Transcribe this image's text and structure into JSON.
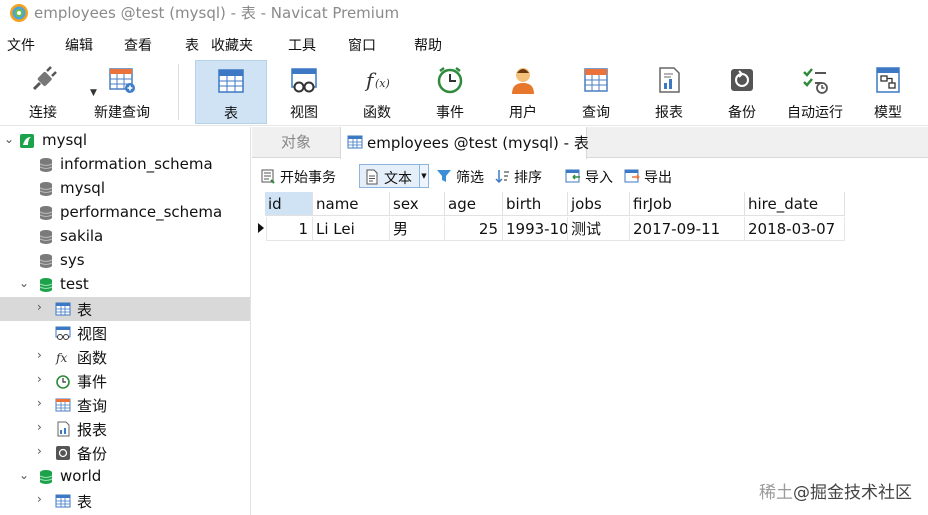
{
  "window": {
    "title": "employees @test (mysql) - 表 - Navicat Premium"
  },
  "menu": [
    "文件",
    "编辑",
    "查看",
    "表",
    "收藏夹",
    "工具",
    "窗口",
    "帮助"
  ],
  "toolbar": {
    "connect": "连接",
    "new_query": "新建查询",
    "table": "表",
    "view": "视图",
    "function": "函数",
    "event": "事件",
    "user": "用户",
    "query": "查询",
    "report": "报表",
    "backup": "备份",
    "automation": "自动运行",
    "model": "模型"
  },
  "tree": {
    "nodes": [
      {
        "label": "mysql"
      },
      {
        "label": "information_schema"
      },
      {
        "label": "mysql"
      },
      {
        "label": "performance_schema"
      },
      {
        "label": "sakila"
      },
      {
        "label": "sys"
      },
      {
        "label": "test"
      },
      {
        "label": "表"
      },
      {
        "label": "视图"
      },
      {
        "label": "函数"
      },
      {
        "label": "事件"
      },
      {
        "label": "查询"
      },
      {
        "label": "报表"
      },
      {
        "label": "备份"
      },
      {
        "label": "world"
      },
      {
        "label": "表"
      }
    ]
  },
  "tabs": {
    "objects": "对象",
    "active": "employees @test (mysql) - 表"
  },
  "subtoolbar": {
    "begin_tx": "开始事务",
    "text": "文本",
    "filter": "筛选",
    "sort": "排序",
    "import": "导入",
    "export": "导出"
  },
  "grid": {
    "columns": [
      "id",
      "name",
      "sex",
      "age",
      "birth",
      "jobs",
      "firJob",
      "hire_date"
    ],
    "rows": [
      [
        "1",
        "Li Lei",
        "男",
        "25",
        "1993-10-",
        "测试",
        "2017-09-11",
        "2018-03-07"
      ]
    ]
  },
  "watermark": {
    "prefix": "稀土",
    "text": "@掘金技术社区"
  },
  "colors": {
    "accent": "#cfe3f5",
    "db_green": "#1aa34a",
    "selection": "#d9d9d9"
  }
}
